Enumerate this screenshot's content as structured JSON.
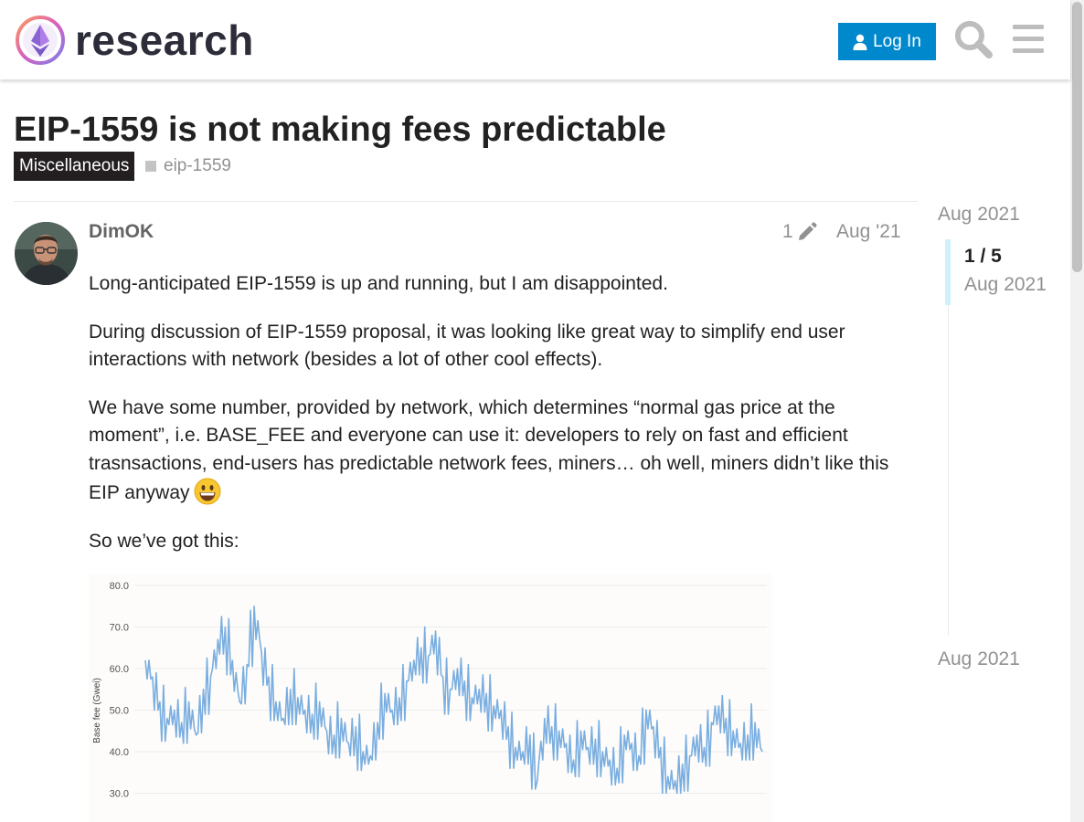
{
  "header": {
    "site_name": "research",
    "login_label": "Log In",
    "search_icon": "search-icon",
    "menu_icon": "hamburger-menu-icon",
    "accent_color": "#0088cc"
  },
  "topic": {
    "title": "EIP-1559 is not making fees predictable",
    "category": "Miscellaneous",
    "tag": "eip-1559"
  },
  "post": {
    "username": "DimOK",
    "edit_count": "1",
    "date": "Aug '21",
    "paragraphs": [
      "Long-anticipated EIP-1559 is up and running, but I am disappointed.",
      "During discussion of EIP-1559 proposal, it was looking like great way to simplify end user interactions with network (besides a lot of other cool effects).",
      "We have some number, provided by network, which determines “normal gas price at the moment”, i.e. BASE_FEE and everyone can use it: developers to rely on fast and efficient trasnsactions, end-users has predictable network fees, miners… oh well, miners didn’t like this EIP anyway",
      "So we’ve got this:"
    ],
    "emoji": "grinning-face-emoji"
  },
  "timeline": {
    "top_date": "Aug 2021",
    "position": "1 / 5",
    "current_date": "Aug 2021",
    "bottom_date": "Aug 2021"
  },
  "chart_data": {
    "type": "line",
    "ylabel": "Base fee (Gwei)",
    "yticks": [
      "80.0",
      "70.0",
      "60.0",
      "50.0",
      "40.0",
      "30.0"
    ],
    "ylim": [
      25,
      81
    ],
    "grid": true,
    "line_color": "#7aaee0",
    "x": [
      0,
      8,
      16,
      24,
      32,
      40,
      48,
      56,
      64,
      72,
      80,
      88,
      96,
      104,
      112,
      120,
      128,
      136,
      144,
      152,
      160,
      168,
      176,
      184,
      192,
      200,
      208,
      216,
      224,
      232,
      240,
      248,
      256,
      264,
      272,
      280,
      288,
      296,
      304,
      312,
      320,
      328,
      336,
      344,
      352,
      360,
      368,
      376,
      384,
      392,
      400,
      408,
      416,
      424,
      432,
      440,
      448,
      456,
      464,
      472,
      480,
      488,
      496,
      504,
      512,
      520,
      528,
      536,
      544,
      552,
      560,
      568,
      576,
      584,
      592,
      600,
      608,
      616,
      624,
      632,
      640,
      648,
      656,
      664,
      672,
      680
    ],
    "values": [
      62,
      58,
      52,
      48,
      50,
      47,
      52,
      44,
      55,
      58,
      67,
      70,
      62,
      52,
      61,
      75,
      64,
      58,
      52,
      48,
      55,
      53,
      50,
      49,
      52,
      45,
      44,
      48,
      42,
      46,
      40,
      39,
      47,
      54,
      50,
      53,
      57,
      62,
      65,
      63,
      69,
      58,
      55,
      60,
      57,
      53,
      55,
      54,
      51,
      50,
      46,
      41,
      40,
      44,
      33,
      48,
      46,
      45,
      42,
      38,
      45,
      41,
      43,
      40,
      38,
      36,
      44,
      42,
      39,
      50,
      46,
      41,
      34,
      33,
      37,
      39,
      44,
      41,
      47,
      51,
      48,
      45,
      42,
      44,
      47,
      40
    ]
  }
}
